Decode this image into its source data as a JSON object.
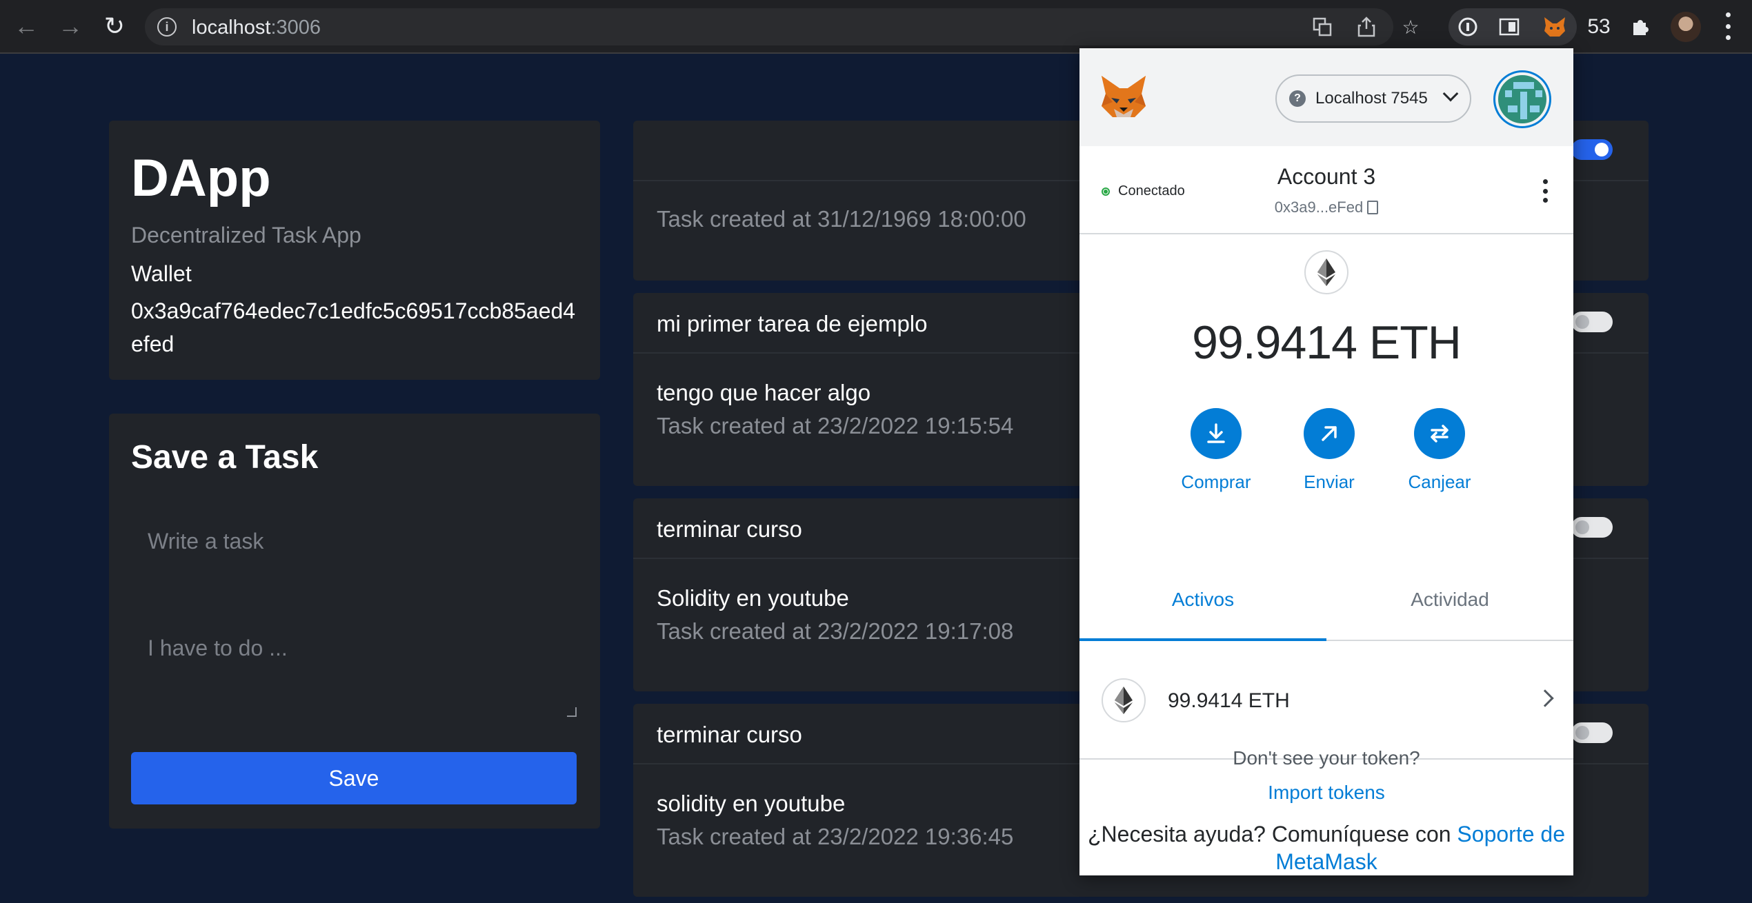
{
  "browser": {
    "url_host": "localhost",
    "url_port": ":3006",
    "extension_badge": "53"
  },
  "sidebar": {
    "app_title": "DApp",
    "app_subtitle": "Decentralized Task App",
    "wallet_label": "Wallet",
    "wallet_address": "0x3a9caf764edec7c1edfc5c69517ccb85aed4efed"
  },
  "form": {
    "title": "Save a Task",
    "title_placeholder": "Write a task",
    "description_placeholder": "I have to do ...",
    "save_label": "Save"
  },
  "tasks": [
    {
      "title": "",
      "description": "",
      "created": "Task created at 31/12/1969 18:00:00",
      "done": true
    },
    {
      "title": "mi primer tarea de ejemplo",
      "description": "tengo que hacer algo",
      "created": "Task created at 23/2/2022 19:15:54",
      "done": false
    },
    {
      "title": "terminar curso",
      "description": "Solidity en youtube",
      "created": "Task created at 23/2/2022 19:17:08",
      "done": false
    },
    {
      "title": "terminar curso",
      "description": "solidity en youtube",
      "created": "Task created at 23/2/2022 19:36:45",
      "done": false
    }
  ],
  "metamask": {
    "network": "Localhost 7545",
    "status": "Conectado",
    "account_name": "Account 3",
    "account_short": "0x3a9...eFed",
    "balance": "99.9414 ETH",
    "actions": {
      "buy": "Comprar",
      "send": "Enviar",
      "swap": "Canjear"
    },
    "tabs": {
      "assets": "Activos",
      "activity": "Actividad"
    },
    "asset_value": "99.9414 ETH",
    "no_token": "Don't see your token?",
    "import_tokens": "Import tokens",
    "help_text": "¿Necesita ayuda? Comuníquese con",
    "help_link": "Soporte de MetaMask"
  },
  "colors": {
    "page_bg": "#0f1b33",
    "card_bg": "#212429",
    "accent": "#2563eb",
    "metamask_blue": "#037dd6"
  }
}
